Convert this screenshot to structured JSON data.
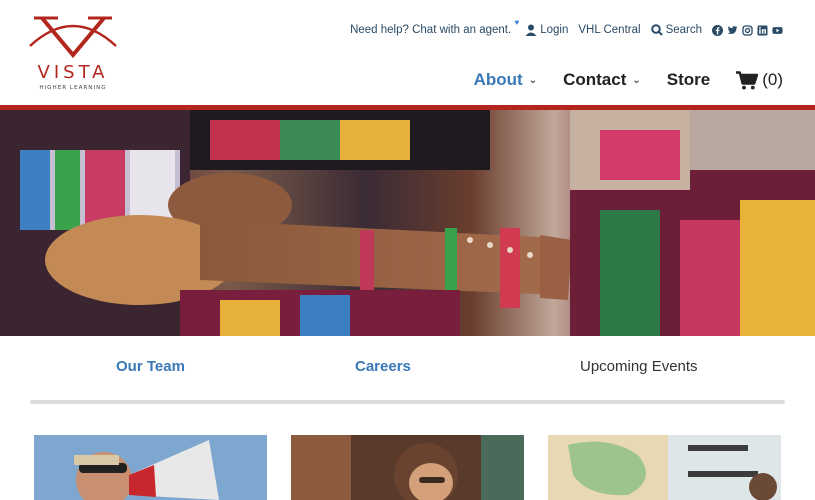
{
  "brand": {
    "name": "VISTA",
    "tagline": "HIGHER LEARNING",
    "color": "#b3261e"
  },
  "utility": {
    "chat": "Need help? Chat with an agent.",
    "login": "Login",
    "vhl_central": "VHL Central",
    "search": "Search",
    "social_icons": [
      "facebook-icon",
      "twitter-icon",
      "instagram-icon",
      "linkedin-icon",
      "youtube-icon"
    ]
  },
  "nav": {
    "items": [
      {
        "label": "About",
        "active": true,
        "dropdown": true
      },
      {
        "label": "Contact",
        "active": false,
        "dropdown": true
      },
      {
        "label": "Store",
        "active": false,
        "dropdown": false
      }
    ],
    "cart_count": "(0)",
    "accent": "#3a78b8"
  },
  "subnav": {
    "tabs": [
      {
        "label": "Our Team"
      },
      {
        "label": "Careers"
      },
      {
        "label": "Upcoming Events"
      }
    ]
  },
  "hero": {
    "icon": "musicians-photo"
  },
  "cards": [
    "megaphone-photo",
    "student-photo",
    "map-photo"
  ]
}
